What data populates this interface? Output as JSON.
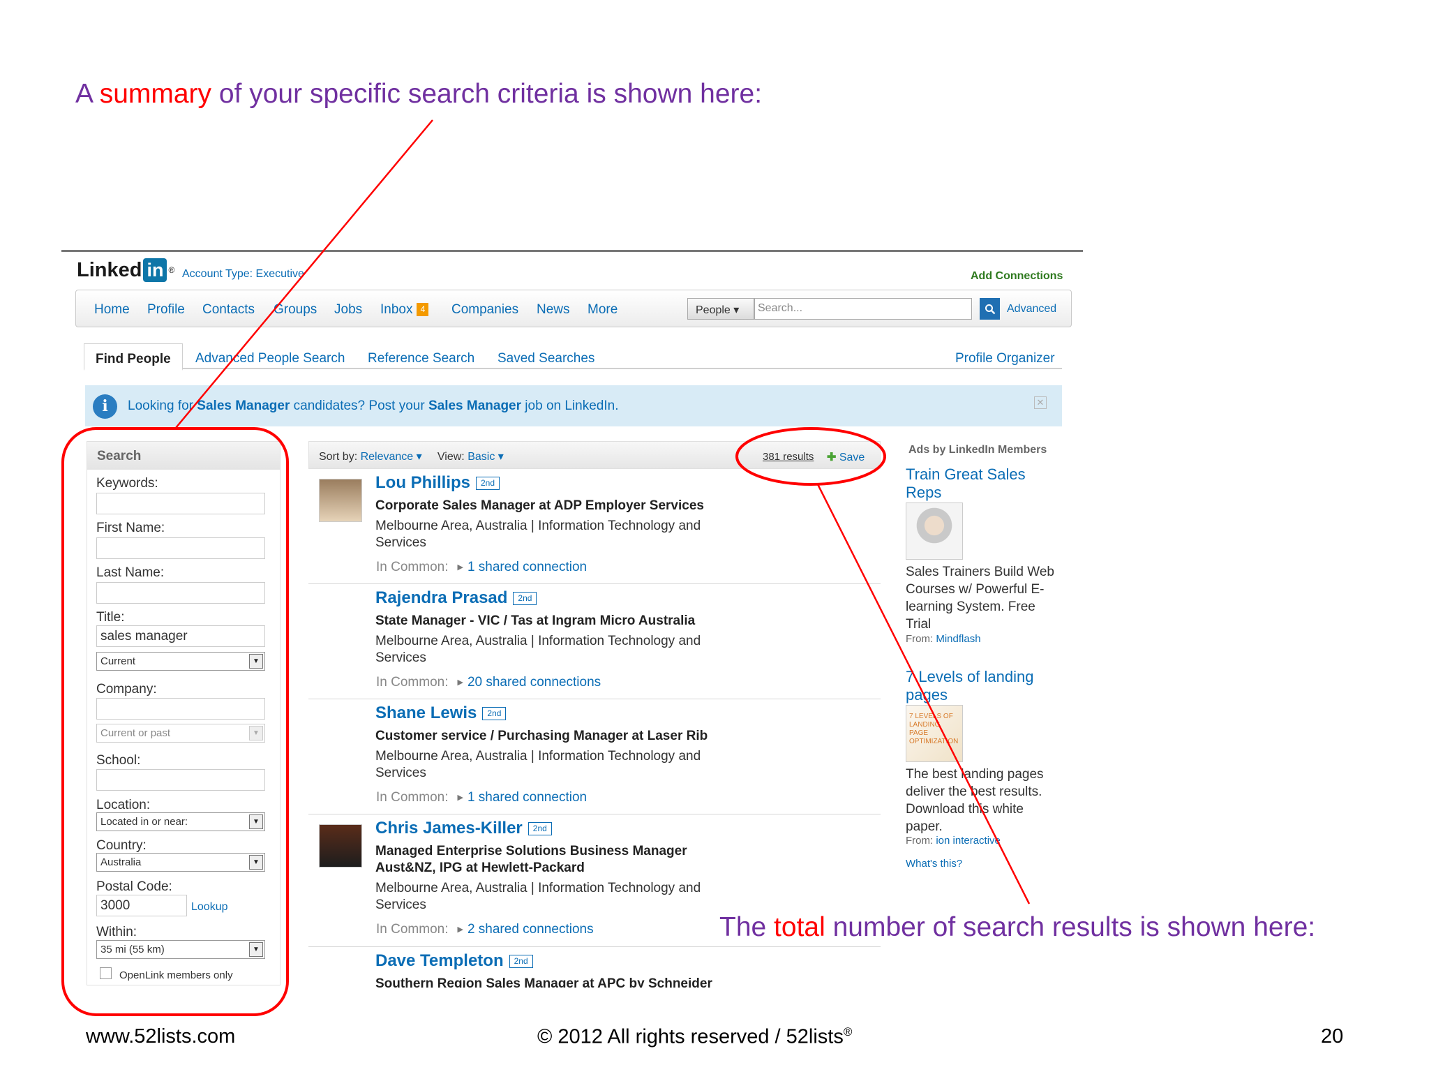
{
  "slide": {
    "annotation_top": {
      "pre": "A ",
      "highlight": "summary",
      "post": " of your specific search criteria is shown here:"
    },
    "annotation_bottom": {
      "pre": "The ",
      "highlight": "total",
      "post": " number of search results is shown here:"
    },
    "footer_left": "www.52lists.com",
    "footer_center": "© 2012 All rights reserved / 52lists",
    "footer_center_mark": "®",
    "page_number": "20",
    "accent_color": "#ff0000",
    "text_color": "#7030a0"
  },
  "header": {
    "logo_text": "Linked",
    "logo_in": "in",
    "logo_reg": "®",
    "account_type": "Account Type: Executive",
    "add_connections": "Add Connections"
  },
  "nav": {
    "items": [
      "Home",
      "Profile",
      "Contacts",
      "Groups",
      "Jobs",
      "Inbox",
      "Companies",
      "News",
      "More"
    ],
    "inbox_count": "4",
    "search_scope": "People ▾",
    "search_placeholder": "Search...",
    "advanced": "Advanced"
  },
  "tabs": [
    "Find People",
    "Advanced People Search",
    "Reference Search",
    "Saved Searches"
  ],
  "profile_organizer": "Profile Organizer",
  "banner": {
    "pre": "Looking for ",
    "term1": "Sales Manager",
    "mid": " candidates? Post your ",
    "term2": "Sales Manager",
    "post": " job on LinkedIn."
  },
  "search_panel": {
    "title": "Search",
    "keywords_label": "Keywords:",
    "keywords_value": "",
    "first_name_label": "First Name:",
    "first_name_value": "",
    "last_name_label": "Last Name:",
    "last_name_value": "",
    "title_label": "Title:",
    "title_value": "sales manager",
    "title_scope": "Current",
    "company_label": "Company:",
    "company_value": "",
    "company_scope": "Current or past",
    "school_label": "School:",
    "school_value": "",
    "location_label": "Location:",
    "location_value": "Located in or near:",
    "country_label": "Country:",
    "country_value": "Australia",
    "postal_label": "Postal Code:",
    "postal_value": "3000",
    "lookup": "Lookup",
    "within_label": "Within:",
    "within_value": "35 mi (55 km)",
    "openlink_label": "OpenLink members only"
  },
  "results_header": {
    "sort_label": "Sort by:",
    "sort_value": "Relevance ▾",
    "view_label": "View:",
    "view_value": "Basic ▾",
    "count": "381 results",
    "save": "Save"
  },
  "results": [
    {
      "name": "Lou Phillips",
      "degree": "2nd",
      "title": "Corporate Sales Manager at ADP Employer Services",
      "location": "Melbourne Area, Australia | Information Technology and Services",
      "common_label": "In Common:",
      "common_value": "1 shared connection"
    },
    {
      "name": "Rajendra Prasad",
      "degree": "2nd",
      "title": "State Manager - VIC / Tas at Ingram Micro Australia",
      "location": "Melbourne Area, Australia | Information Technology and Services",
      "common_label": "In Common:",
      "common_value": "20 shared connections"
    },
    {
      "name": "Shane Lewis",
      "degree": "2nd",
      "title": "Customer service / Purchasing Manager at Laser Rib",
      "location": "Melbourne Area, Australia | Information Technology and Services",
      "common_label": "In Common:",
      "common_value": "1 shared connection"
    },
    {
      "name": "Chris James-Killer",
      "degree": "2nd",
      "title": "Managed Enterprise Solutions Business Manager Aust&NZ, IPG at Hewlett-Packard",
      "location": "Melbourne Area, Australia | Information Technology and Services",
      "common_label": "In Common:",
      "common_value": "2 shared connections"
    },
    {
      "name": "Dave Templeton",
      "degree": "2nd",
      "title": "Southern Region Sales Manager at APC by Schneider"
    }
  ],
  "ads": {
    "heading": "Ads by LinkedIn Members",
    "items": [
      {
        "title": "Train Great Sales Reps",
        "text": "Sales Trainers Build Web Courses w/ Powerful E-learning System. Free Trial",
        "from_label": "From:",
        "from_value": "Mindflash"
      },
      {
        "title": "7 Levels of landing pages",
        "img_text": "7 LEVELS OF LANDING PAGE OPTIMIZATION",
        "text": "The best landing pages deliver the best results. Download this white paper.",
        "from_label": "From:",
        "from_value": "ion interactive"
      }
    ],
    "whats_this": "What's this?"
  }
}
